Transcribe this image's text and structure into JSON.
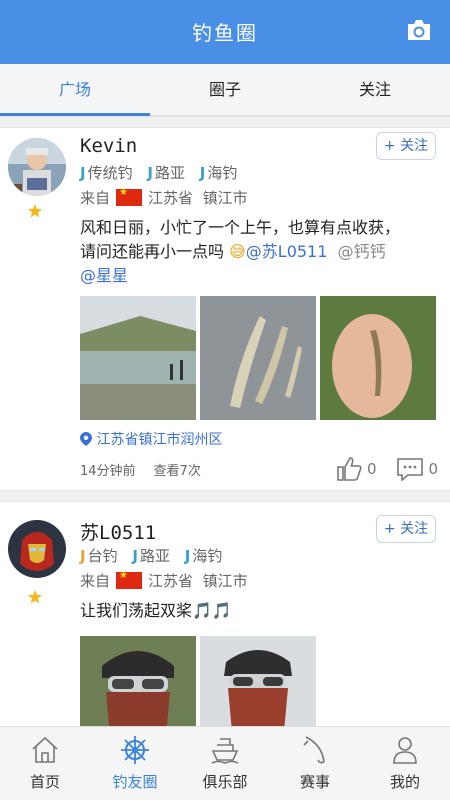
{
  "header": {
    "title": "钓鱼圈"
  },
  "tabs": [
    {
      "label": "广场"
    },
    {
      "label": "圈子"
    },
    {
      "label": "关注"
    }
  ],
  "posts": [
    {
      "username": "Kevin",
      "follow_label": "+ 关注",
      "tags": [
        "传统钓",
        "路亚",
        "海钓"
      ],
      "from_label": "来自",
      "province": "江苏省",
      "city": "镇江市",
      "text_line1": "风和日丽，小忙了一个上午，也算有点收获，",
      "text_line2": "请问还能再小一点吗 ",
      "mention1": "@苏L0511",
      "mention2": "@钙钙",
      "mention3": "@星星",
      "location": "江苏省镇江市润州区",
      "time": "14分钟前",
      "views": "查看7次",
      "likes": "0",
      "comments": "0"
    },
    {
      "username": "苏L0511",
      "follow_label": "+ 关注",
      "tags": [
        "台钓",
        "路亚",
        "海钓"
      ],
      "from_label": "来自",
      "province": "江苏省",
      "city": "镇江市",
      "text_line1": "让我们荡起双桨🎵🎵"
    }
  ],
  "bottom_nav": [
    {
      "label": "首页",
      "icon": "home-icon"
    },
    {
      "label": "钓友圈",
      "icon": "helm-icon"
    },
    {
      "label": "俱乐部",
      "icon": "ship-icon"
    },
    {
      "label": "赛事",
      "icon": "rod-icon"
    },
    {
      "label": "我的",
      "icon": "person-icon"
    }
  ],
  "colors": {
    "primary": "#4a8fe6",
    "active": "#3a83de",
    "mention": "#3a6fd8"
  }
}
